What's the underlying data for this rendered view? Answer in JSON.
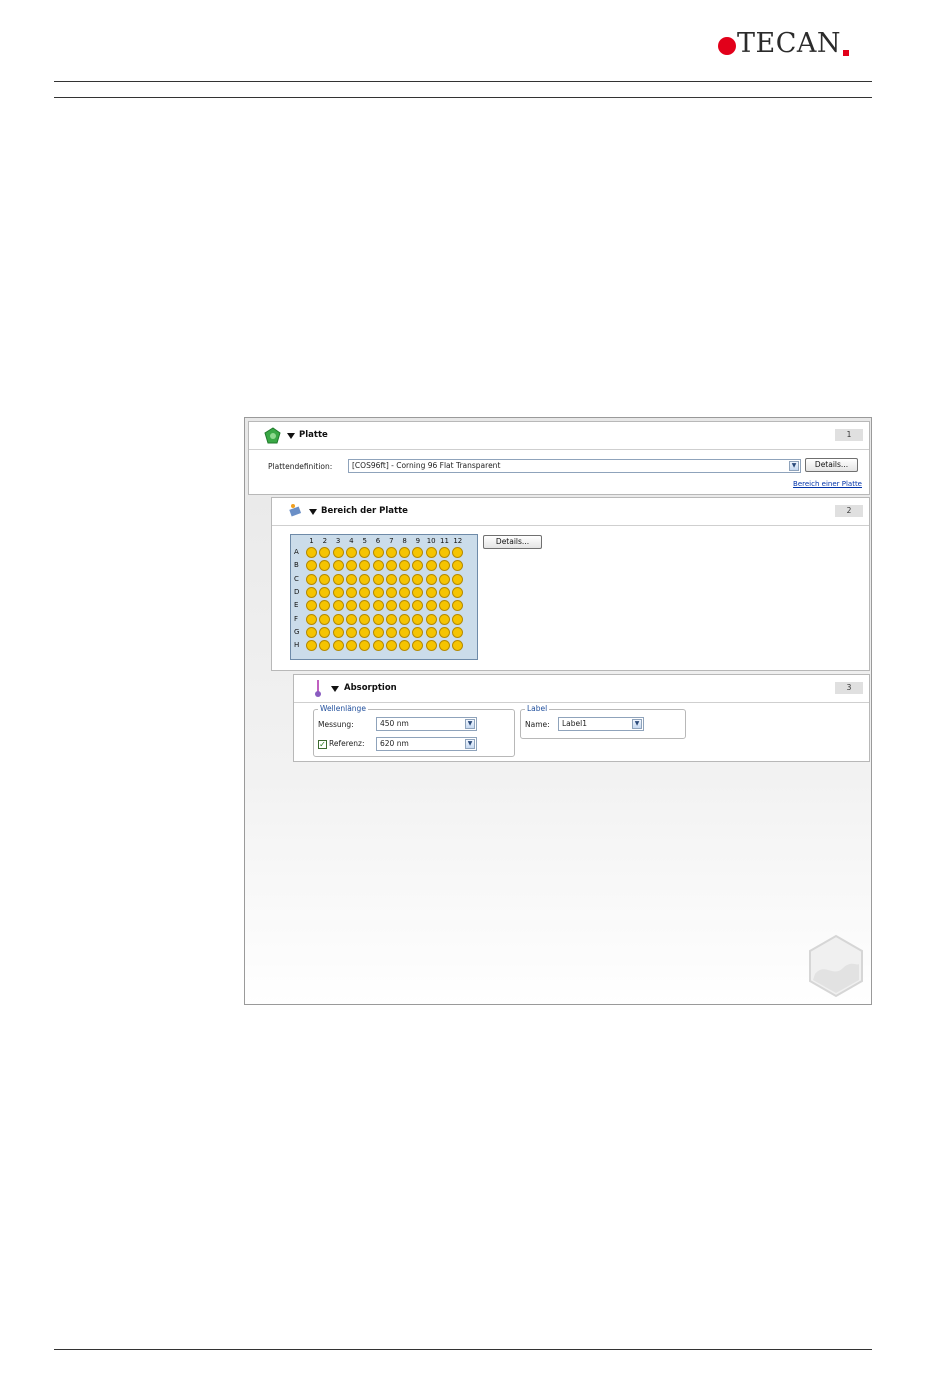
{
  "brand": {
    "name": "TECAN"
  },
  "panel_platte": {
    "title": "Platte",
    "number": "1",
    "definition_label": "Plattendefinition:",
    "definition_value": "[COS96ft] - Corning 96 Flat Transparent",
    "details_button": "Details...",
    "link": "Bereich einer Platte"
  },
  "panel_bereich": {
    "title": "Bereich der Platte",
    "number": "2",
    "details_button": "Details...",
    "columns": [
      "1",
      "2",
      "3",
      "4",
      "5",
      "6",
      "7",
      "8",
      "9",
      "10",
      "11",
      "12"
    ],
    "rows": [
      "A",
      "B",
      "C",
      "D",
      "E",
      "F",
      "G",
      "H"
    ],
    "well_color": "#f5c400"
  },
  "panel_absorption": {
    "title": "Absorption",
    "number": "3",
    "wavelength_group": "Wellenlänge",
    "measure_label": "Messung:",
    "measure_value": "450 nm",
    "reference_label": "Referenz:",
    "reference_checked": true,
    "reference_value": "620 nm",
    "label_group": "Label",
    "name_label": "Name:",
    "name_value": "Label1"
  },
  "colors": {
    "accent": "#1f4e9c",
    "brand_red": "#e2001a"
  }
}
